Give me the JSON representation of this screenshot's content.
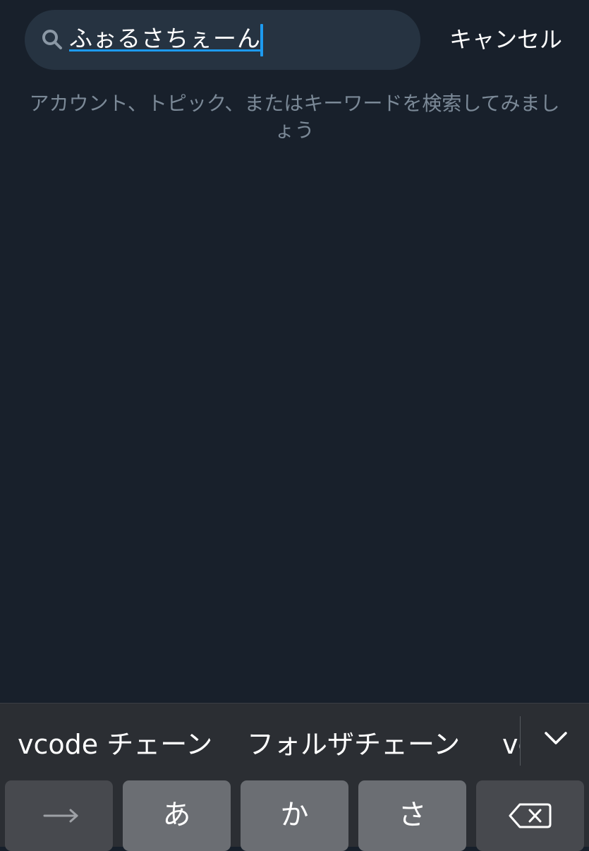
{
  "search": {
    "query": "ふぉるさちぇーん",
    "cancel_label": "キャンセル",
    "hint": "アカウント、トピック、またはキーワードを検索してみましょう"
  },
  "keyboard": {
    "candidates": [
      "vcode チェーン",
      "フォルザチェーン",
      "vc"
    ],
    "keys": {
      "arrow_icon": "right-arrow-icon",
      "a": "あ",
      "ka": "か",
      "sa": "さ",
      "delete_icon": "delete-backward-icon"
    }
  },
  "colors": {
    "background": "#18202b",
    "search_field": "#263341",
    "accent": "#1d9bf0",
    "hint_text": "#7b8997",
    "keyboard": "#2b2e33"
  }
}
